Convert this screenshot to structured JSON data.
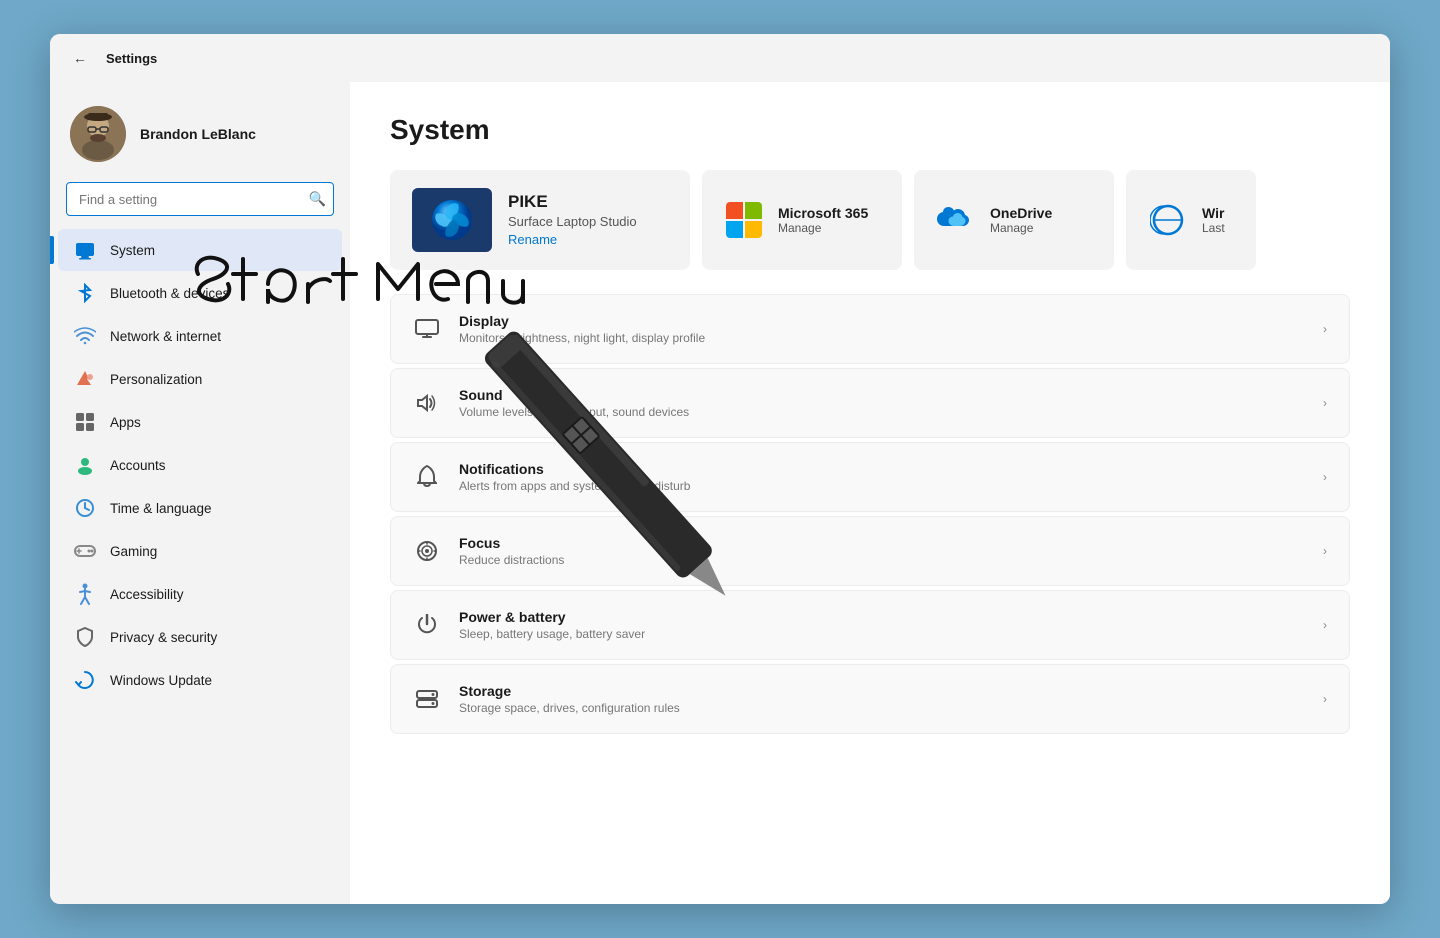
{
  "titleBar": {
    "title": "Settings"
  },
  "sidebar": {
    "user": {
      "name": "Brandon LeBlanc"
    },
    "search": {
      "placeholder": "Find a setting"
    },
    "items": [
      {
        "id": "system",
        "label": "System",
        "icon": "system",
        "active": true
      },
      {
        "id": "bluetooth",
        "label": "Bluetooth & devices",
        "icon": "bluetooth",
        "active": false
      },
      {
        "id": "network",
        "label": "Network & internet",
        "icon": "network",
        "active": false
      },
      {
        "id": "personalization",
        "label": "Personalization",
        "icon": "personalization",
        "active": false
      },
      {
        "id": "apps",
        "label": "Apps",
        "icon": "apps",
        "active": false
      },
      {
        "id": "accounts",
        "label": "Accounts",
        "icon": "accounts",
        "active": false
      },
      {
        "id": "time",
        "label": "Time & language",
        "icon": "time",
        "active": false
      },
      {
        "id": "gaming",
        "label": "Gaming",
        "icon": "gaming",
        "active": false
      },
      {
        "id": "accessibility",
        "label": "Accessibility",
        "icon": "accessibility",
        "active": false
      },
      {
        "id": "privacy",
        "label": "Privacy & security",
        "icon": "privacy",
        "active": false
      },
      {
        "id": "update",
        "label": "Windows Update",
        "icon": "update",
        "active": false
      }
    ]
  },
  "main": {
    "title": "System",
    "device": {
      "name": "PIKE",
      "model": "Surface Laptop Studio",
      "renameLabel": "Rename"
    },
    "apps": [
      {
        "id": "ms365",
        "name": "Microsoft 365",
        "action": "Manage"
      },
      {
        "id": "onedrive",
        "name": "OneDrive",
        "action": "Manage"
      },
      {
        "id": "wir",
        "name": "Wir",
        "action": "Last"
      }
    ],
    "settingsItems": [
      {
        "id": "display",
        "title": "Display",
        "desc": "Monitors, brightness, night light, display profile"
      },
      {
        "id": "sound",
        "title": "Sound",
        "desc": "Volume levels, output, input, sound devices"
      },
      {
        "id": "notifications",
        "title": "Notifications",
        "desc": "Alerts from apps and system, do not disturb"
      },
      {
        "id": "focus",
        "title": "Focus",
        "desc": "Reduce distractions"
      },
      {
        "id": "power",
        "title": "Power & battery",
        "desc": "Sleep, battery usage, battery saver"
      },
      {
        "id": "storage",
        "title": "Storage",
        "desc": "Storage space, drives, configuration rules"
      }
    ]
  }
}
